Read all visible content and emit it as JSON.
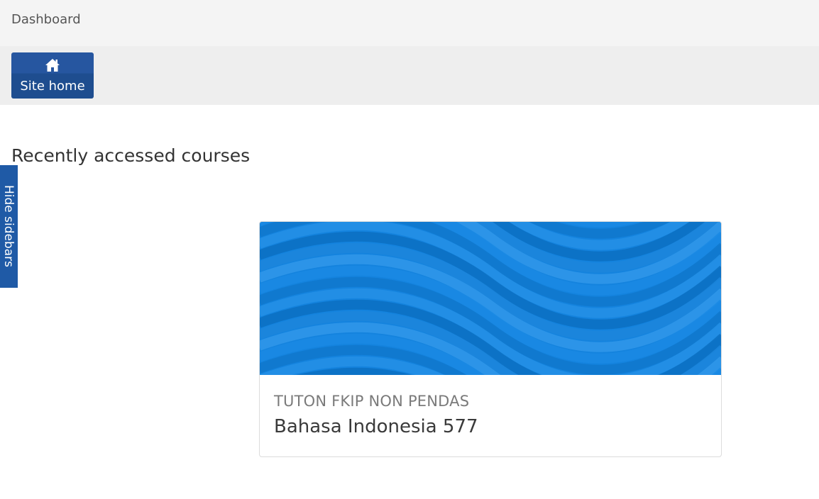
{
  "breadcrumb": {
    "current": "Dashboard"
  },
  "toolbar": {
    "site_home_label": "Site home",
    "site_home_icon": "home-icon"
  },
  "sidebar_toggle": {
    "label": "Hide sidebars"
  },
  "recent_courses": {
    "title": "Recently accessed courses",
    "courses": [
      {
        "category": "TUTON FKIP NON PENDAS",
        "name": "Bahasa Indonesia 577"
      }
    ]
  },
  "colors": {
    "button_bg": "#2656a0",
    "sidebar_toggle_bg": "#1f5aa6",
    "course_image_base": "#1483de",
    "breadcrumb_bg": "#f4f4f4",
    "toolbar_bg": "#eeeeee"
  }
}
